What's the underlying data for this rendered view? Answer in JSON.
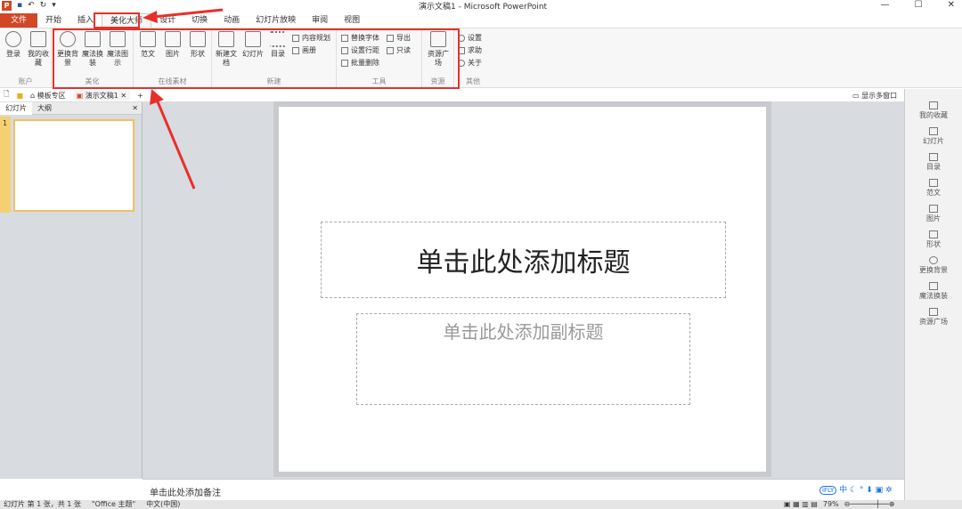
{
  "window": {
    "title": "演示文稿1 - Microsoft PowerPoint",
    "app_logo": "P"
  },
  "tabs": [
    "文件",
    "开始",
    "插入",
    "美化大师",
    "设计",
    "切换",
    "动画",
    "幻灯片放映",
    "审阅",
    "视图"
  ],
  "ribbon": {
    "groups": [
      {
        "label": "账户",
        "buttons": [
          "登录",
          "我的收藏"
        ]
      },
      {
        "label": "美化",
        "buttons": [
          "更换背景",
          "魔法换装",
          "魔法图示"
        ]
      },
      {
        "label": "在线素材",
        "buttons": [
          "范文",
          "图片",
          "形状"
        ]
      },
      {
        "label": "新建",
        "buttons": [
          "新建文档",
          "幻灯片",
          "目录"
        ],
        "small": [
          "内容规划",
          "画册"
        ]
      },
      {
        "label": "工具",
        "small": [
          "替换字体",
          "导出",
          "设置行距",
          "只读",
          "批量删除"
        ]
      },
      {
        "label": "资源",
        "buttons": [
          "资源广场"
        ]
      },
      {
        "label": "其他",
        "small": [
          "设置",
          "求助",
          "关于"
        ]
      }
    ]
  },
  "doc_tabs": {
    "template": "模板专区",
    "doc": "演示文稿1",
    "show_multi": "显示多窗口"
  },
  "left_panel": {
    "tabs": [
      "幻灯片",
      "大纲"
    ],
    "slide_number": "1"
  },
  "slide": {
    "title_placeholder": "单击此处添加标题",
    "subtitle_placeholder": "单击此处添加副标题"
  },
  "notes_placeholder": "单击此处添加备注",
  "right_panel": [
    "我的收藏",
    "幻灯片",
    "目录",
    "范文",
    "图片",
    "形状",
    "更换背景",
    "魔法换装",
    "资源广场"
  ],
  "status": {
    "slide": "幻灯片 第 1 张，共 1 张",
    "theme": "\"Office 主题\"",
    "lang": "中文(中国)",
    "zoom": "79%"
  },
  "ime": {
    "label": "iFLY",
    "mode": "中"
  },
  "annotation_color": "#e8302a"
}
